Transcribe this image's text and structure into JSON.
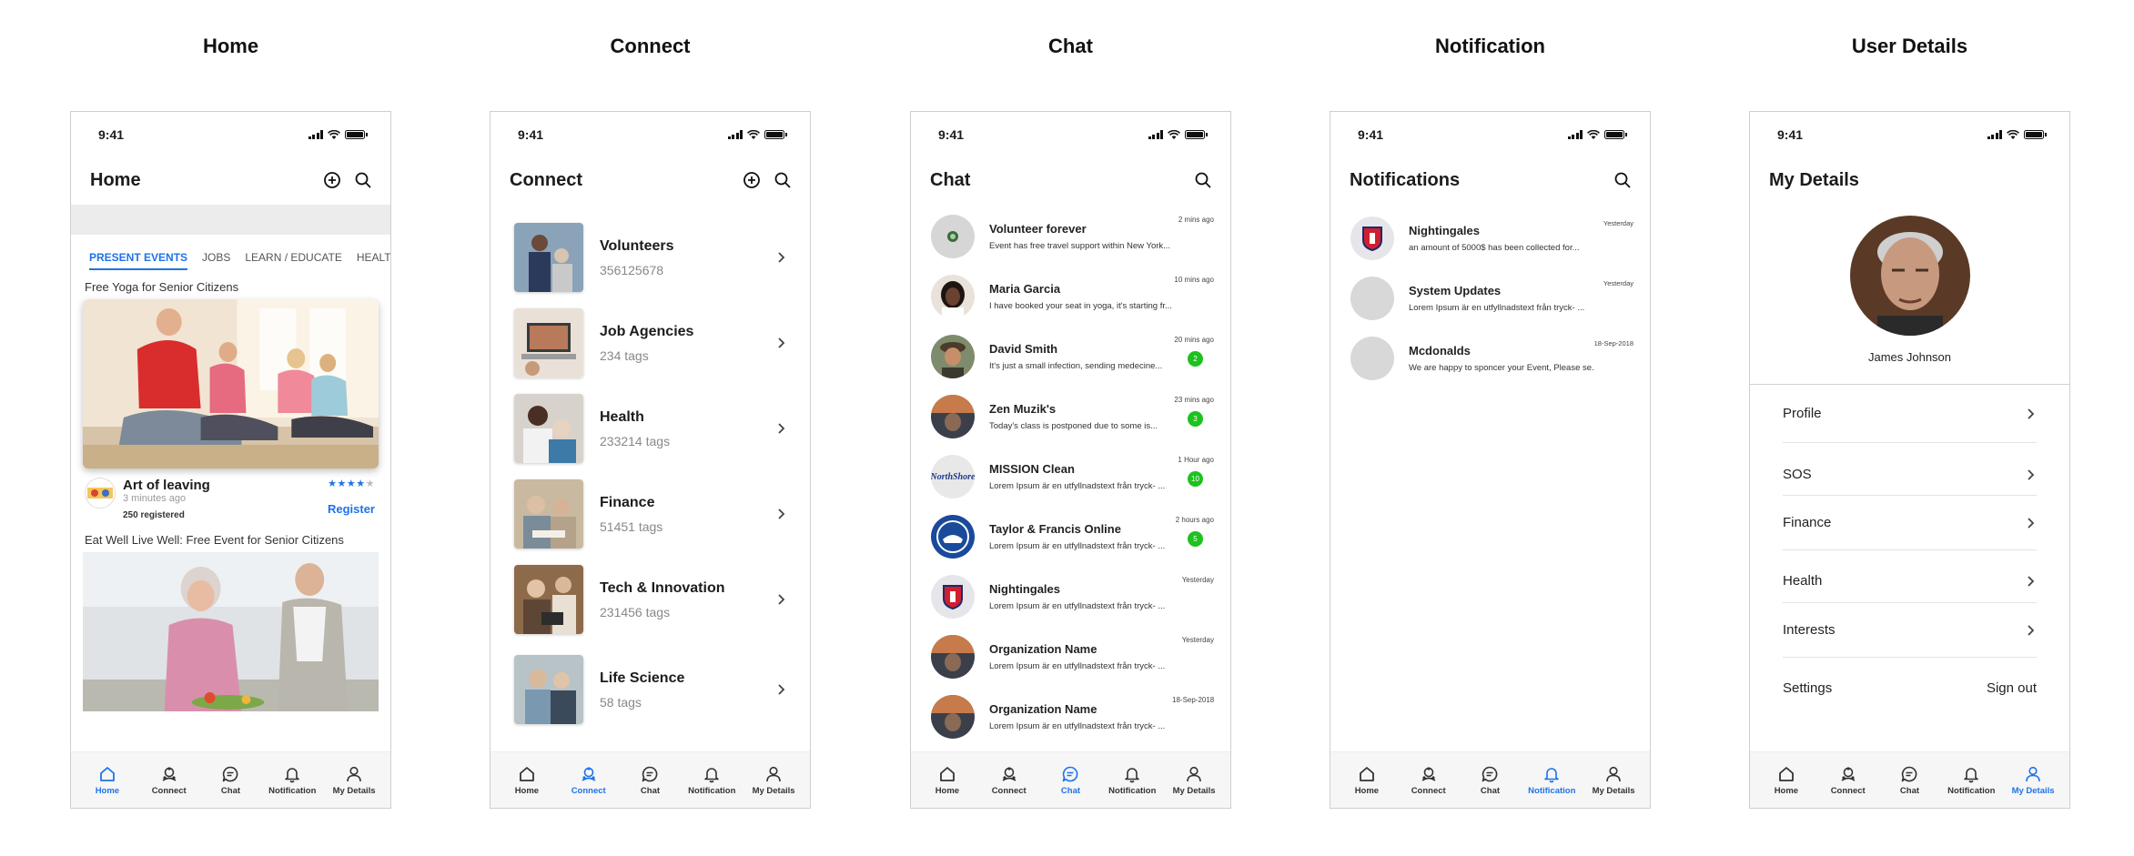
{
  "screens": {
    "home": {
      "title": "Home"
    },
    "connect": {
      "title": "Connect"
    },
    "chat": {
      "title": "Chat"
    },
    "notification": {
      "title": "Notification"
    },
    "details": {
      "title": "User Details"
    }
  },
  "status_time": "9:41",
  "icons": [
    "add-icon",
    "search-icon",
    "chevron-right-icon",
    "home-icon",
    "connect-icon",
    "chat-icon",
    "bell-icon",
    "user-icon",
    "signal-icon",
    "wifi-icon",
    "battery-icon"
  ],
  "colors": {
    "accent": "#1e73e8",
    "unread": "#1ec21e",
    "band": "#ececec"
  },
  "nav": {
    "home": "Home",
    "connect": "Connect",
    "chat": "Chat",
    "notification": "Notification",
    "details": "My Details"
  },
  "home": {
    "header": "Home",
    "tabs": [
      "PRESENT EVENTS",
      "JOBS",
      "LEARN / EDUCATE",
      "HEALTH A"
    ],
    "event1": {
      "title": "Free Yoga for Senior Citizens",
      "org": "Art of leaving",
      "ago": "3 minutes ago",
      "registered": "250 registered",
      "rating": 4,
      "register": "Register"
    },
    "event2": {
      "title": "Eat Well Live Well: Free Event for Senior Citizens"
    }
  },
  "connect": {
    "header": "Connect",
    "items": [
      {
        "name": "Volunteers",
        "sub": "356125678"
      },
      {
        "name": "Job Agencies",
        "sub": "234 tags"
      },
      {
        "name": "Health",
        "sub": "233214 tags"
      },
      {
        "name": "Finance",
        "sub": "51451 tags"
      },
      {
        "name": "Tech & Innovation",
        "sub": "231456 tags"
      },
      {
        "name": "Life Science",
        "sub": "58 tags"
      }
    ]
  },
  "chat": {
    "header": "Chat",
    "items": [
      {
        "name": "Volunteer forever",
        "msg": "Event has free travel support within New York...",
        "time": "2 mins ago",
        "unread": ""
      },
      {
        "name": "Maria Garcia",
        "msg": "I have booked your seat in yoga, it's starting fr...",
        "time": "10 mins ago",
        "unread": ""
      },
      {
        "name": "David Smith",
        "msg": "It's just a small infection, sending medecine...",
        "time": "20 mins ago",
        "unread": "2"
      },
      {
        "name": "Zen Muzik's",
        "msg": "Today's class is postponed due to some is...",
        "time": "23 mins ago",
        "unread": "3"
      },
      {
        "name": "MISSION Clean",
        "msg": "Lorem Ipsum är en utfyllnadstext från tryck- ...",
        "time": "1 Hour ago",
        "unread": "10"
      },
      {
        "name": "Taylor & Francis Online",
        "msg": "Lorem Ipsum är en utfyllnadstext från tryck- ...",
        "time": "2 hours ago",
        "unread": "5"
      },
      {
        "name": "Nightingales",
        "msg": "Lorem Ipsum är en utfyllnadstext från tryck- ...",
        "time": "Yesterday",
        "unread": ""
      },
      {
        "name": "Organization Name",
        "msg": "Lorem Ipsum är en utfyllnadstext från tryck- ...",
        "time": "Yesterday",
        "unread": ""
      },
      {
        "name": "Organization Name",
        "msg": "Lorem Ipsum är en utfyllnadstext från tryck- ...",
        "time": "18-Sep-2018",
        "unread": ""
      }
    ],
    "logo_text": "NorthShore"
  },
  "notification": {
    "header": "Notifications",
    "items": [
      {
        "title": "Nightingales",
        "text": "an amount of 5000$ has been collected for...",
        "time": "Yesterday"
      },
      {
        "title": "System Updates",
        "text": "Lorem Ipsum är en utfyllnadstext från tryck- ...",
        "time": "Yesterday"
      },
      {
        "title": "Mcdonalds",
        "text": "We are happy to sponcer your Event, Please se...",
        "time": "18-Sep-2018"
      }
    ]
  },
  "details": {
    "header": "My Details",
    "name": "James Johnson",
    "items": [
      "Profile",
      "SOS",
      "Finance",
      "Health",
      "Interests"
    ],
    "settings": "Settings",
    "signout": "Sign out"
  }
}
